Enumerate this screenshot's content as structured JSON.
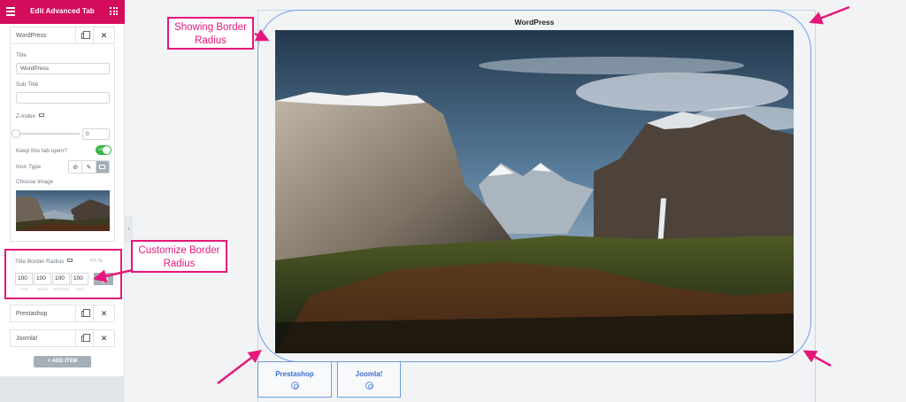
{
  "sidebar": {
    "header_title": "Edit Advanced Tab",
    "tabs": [
      {
        "label": "WordPress"
      },
      {
        "label": "Prestashop"
      },
      {
        "label": "Joomla!"
      }
    ],
    "title_label": "Title",
    "title_value": "WordPress",
    "subtitle_label": "Sub Title",
    "subtitle_value": "",
    "zindex_label": "Z-Index",
    "zindex_value": "0",
    "keep_open_label": "Keep this tab open?",
    "toggle_text": "YES",
    "icon_type_label": "Icon Type",
    "choose_image_label": "Choose Image",
    "border_radius_label": "Title Border Radius",
    "units": "PX  %",
    "radius_values": [
      "100",
      "100",
      "100",
      "100"
    ],
    "radius_sides": [
      "TOP",
      "RIGHT",
      "BOTTOM",
      "LEFT"
    ],
    "add_item_label": "+ ADD ITEM",
    "collapse_glyph": "‹"
  },
  "preview": {
    "active_title": "WordPress",
    "tabs": [
      {
        "label": "Prestashop"
      },
      {
        "label": "Joomla!"
      }
    ]
  },
  "annotations": {
    "showing_border_radius": "Showing Border Radius",
    "customize_border_radius": "Customize Border Radius",
    "accent_color": "#e6177a",
    "header_color": "#d30c5c",
    "frame_color": "#6d9ce2"
  },
  "icons": [
    "hamburger-icon",
    "apps-grid-icon",
    "copy-icon",
    "close-icon",
    "monitor-icon",
    "ban-icon",
    "brush-icon",
    "image-icon",
    "link-icon",
    "collapse-arrow-icon",
    "tab-logo-icon"
  ]
}
